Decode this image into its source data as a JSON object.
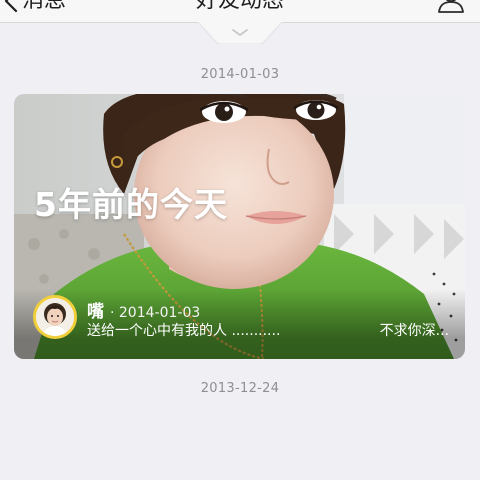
{
  "nav": {
    "back_label": "消息",
    "title": "好友动态"
  },
  "dates": {
    "first": "2014-01-03",
    "second": "2013-12-24"
  },
  "memory_card": {
    "heading": "5年前的今天",
    "author_name": "嘴",
    "author_date": "· 2014-01-03",
    "post_text": "送给一个心中有我的人 ...........",
    "post_text_right": "不求你深..."
  },
  "colors": {
    "background": "#efeff4",
    "avatar_ring": "#f1cf3b",
    "date_text": "#8e8e93"
  },
  "icons": {
    "back": "chevron-left-icon",
    "profile": "person-icon",
    "pulldown": "chevron-down-icon"
  }
}
